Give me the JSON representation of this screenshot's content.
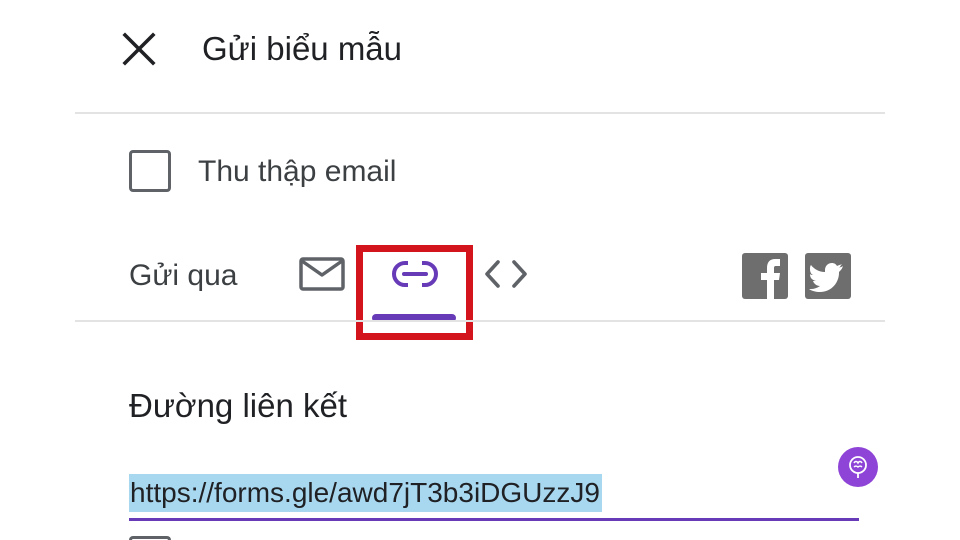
{
  "dialog": {
    "title": "Gửi biểu mẫu",
    "close_icon": "close-icon"
  },
  "collect_email": {
    "label": "Thu thập email",
    "checked": false
  },
  "send_via": {
    "label": "Gửi qua",
    "tabs": [
      {
        "icon": "mail-icon",
        "selected": false
      },
      {
        "icon": "link-icon",
        "selected": true
      },
      {
        "icon": "embed-code-icon",
        "selected": false
      }
    ],
    "social": [
      {
        "icon": "facebook-icon"
      },
      {
        "icon": "twitter-icon"
      }
    ]
  },
  "link_section": {
    "heading": "Đường liên kết",
    "url": "https://forms.gle/awd7jT3b3iDGUzzJ9"
  },
  "colors": {
    "accent": "#673ab7",
    "highlight_border": "#d3141d",
    "selection": "#a8d8f0",
    "social_icon_bg": "#6e6e6e"
  }
}
